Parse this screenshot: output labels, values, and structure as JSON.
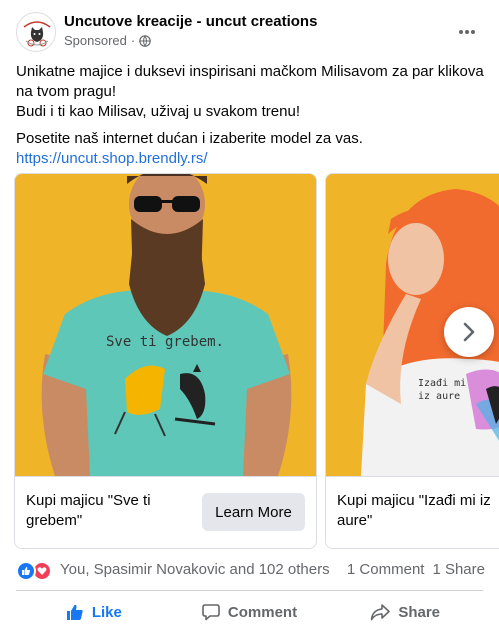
{
  "header": {
    "page_name": "Uncutove kreacije - uncut creations",
    "sponsored": "Sponsored",
    "separator": "·",
    "globe_icon": "globe-icon",
    "more_icon": "more-horizontal-icon"
  },
  "post": {
    "line1": "Unikatne majice i duksevi inspirisani mačkom Milisavom za par klikova na tvom pragu!",
    "line2": "Budi i ti kao Milisav, uživaj u svakom trenu!",
    "line3": "Posetite naš internet dućan i izaberite model za vas.",
    "link": "https://uncut.shop.brendly.rs/"
  },
  "carousel": {
    "cards": [
      {
        "title": "Kupi majicu \"Sve ti grebem\"",
        "cta": "Learn More",
        "shirt_text": "Sve ti grebem.",
        "image_colors": {
          "background": "#f0b429",
          "shirt": "#5ec7b8"
        }
      },
      {
        "title": "Kupi majicu \"Izađi mi iz aure\"",
        "shirt_text": "Izađi mi iz aure",
        "image_colors": {
          "background": "#f0b429",
          "hair": "#f26b2e",
          "shirt": "#f2f2f2"
        }
      }
    ],
    "next_icon": "chevron-right-icon"
  },
  "reactions": {
    "icons": [
      "like-reaction-icon",
      "love-reaction-icon"
    ],
    "text": "You, Spasimir Novakovic and 102 others",
    "comments": "1 Comment",
    "shares": "1 Share"
  },
  "actions": {
    "like": "Like",
    "comment": "Comment",
    "share": "Share"
  },
  "colors": {
    "accent": "#1877f2",
    "link": "#216fdb",
    "secondary_text": "#65676b",
    "button_bg": "#e4e6eb",
    "love": "#f33e58"
  }
}
